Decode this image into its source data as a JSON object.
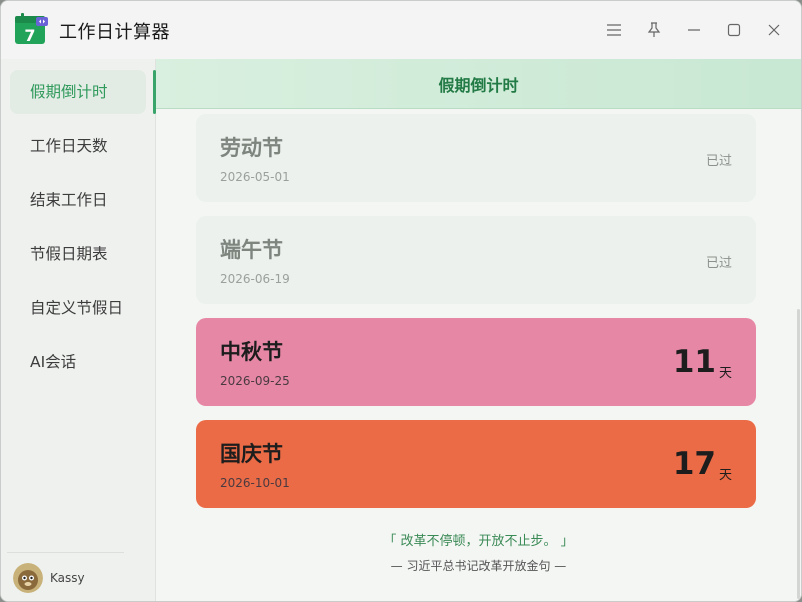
{
  "app": {
    "title": "工作日计算器",
    "icon_number": "7",
    "icon_name": "calendar-icon"
  },
  "titlebar": {
    "buttons": [
      "menu-icon",
      "pin-icon",
      "minimize-icon",
      "maximize-icon",
      "close-icon"
    ]
  },
  "sidebar": {
    "items": [
      {
        "label": "假期倒计时",
        "active": true
      },
      {
        "label": "工作日天数",
        "active": false
      },
      {
        "label": "结束工作日",
        "active": false
      },
      {
        "label": "节假日期表",
        "active": false
      },
      {
        "label": "自定义节假日",
        "active": false
      },
      {
        "label": "AI会话",
        "active": false
      }
    ],
    "user": {
      "name": "Kassy"
    }
  },
  "main": {
    "header_title": "假期倒计时",
    "cards": [
      {
        "name": "劳动节",
        "date": "2026-05-01",
        "status": "已过",
        "state": "past"
      },
      {
        "name": "端午节",
        "date": "2026-06-19",
        "status": "已过",
        "state": "past"
      },
      {
        "name": "中秋节",
        "date": "2026-09-25",
        "days": "11",
        "unit": "天",
        "state": "future",
        "color": "#e687a6"
      },
      {
        "name": "国庆节",
        "date": "2026-10-01",
        "days": "17",
        "unit": "天",
        "state": "future",
        "color": "#ea6b46"
      }
    ],
    "quote": "「 改革不停顿，开放不止步。 」",
    "quote_source": "— 习近平总书记改革开放金句 —"
  },
  "colors": {
    "accent": "#2f9a5b",
    "header_bg": "#d9efdf",
    "mid_autumn": "#e687a6",
    "national_day": "#ea6b46"
  }
}
